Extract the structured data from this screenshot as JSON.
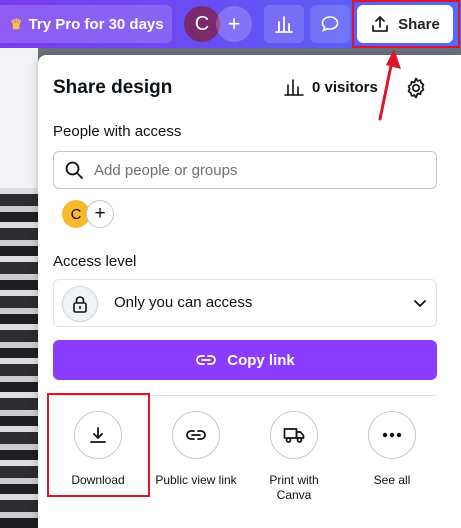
{
  "toolbar": {
    "try_pro_label": "Try Pro for 30 days",
    "avatar_initial": "C",
    "share_label": "Share"
  },
  "panel": {
    "title": "Share design",
    "visitors_label": "0 visitors",
    "people_label": "People with access",
    "search_placeholder": "Add people or groups",
    "person_initial": "C",
    "access_level_label": "Access level",
    "access_value": "Only you can access",
    "copy_link_label": "Copy link",
    "actions": [
      {
        "label": "Download"
      },
      {
        "label": "Public view link"
      },
      {
        "label": "Print with Canva"
      },
      {
        "label": "See all"
      }
    ]
  },
  "colors": {
    "accent": "#8b3dff",
    "highlight": "#e0132c",
    "avatar": "#7b2a6b",
    "person_avatar": "#f5b82e"
  }
}
